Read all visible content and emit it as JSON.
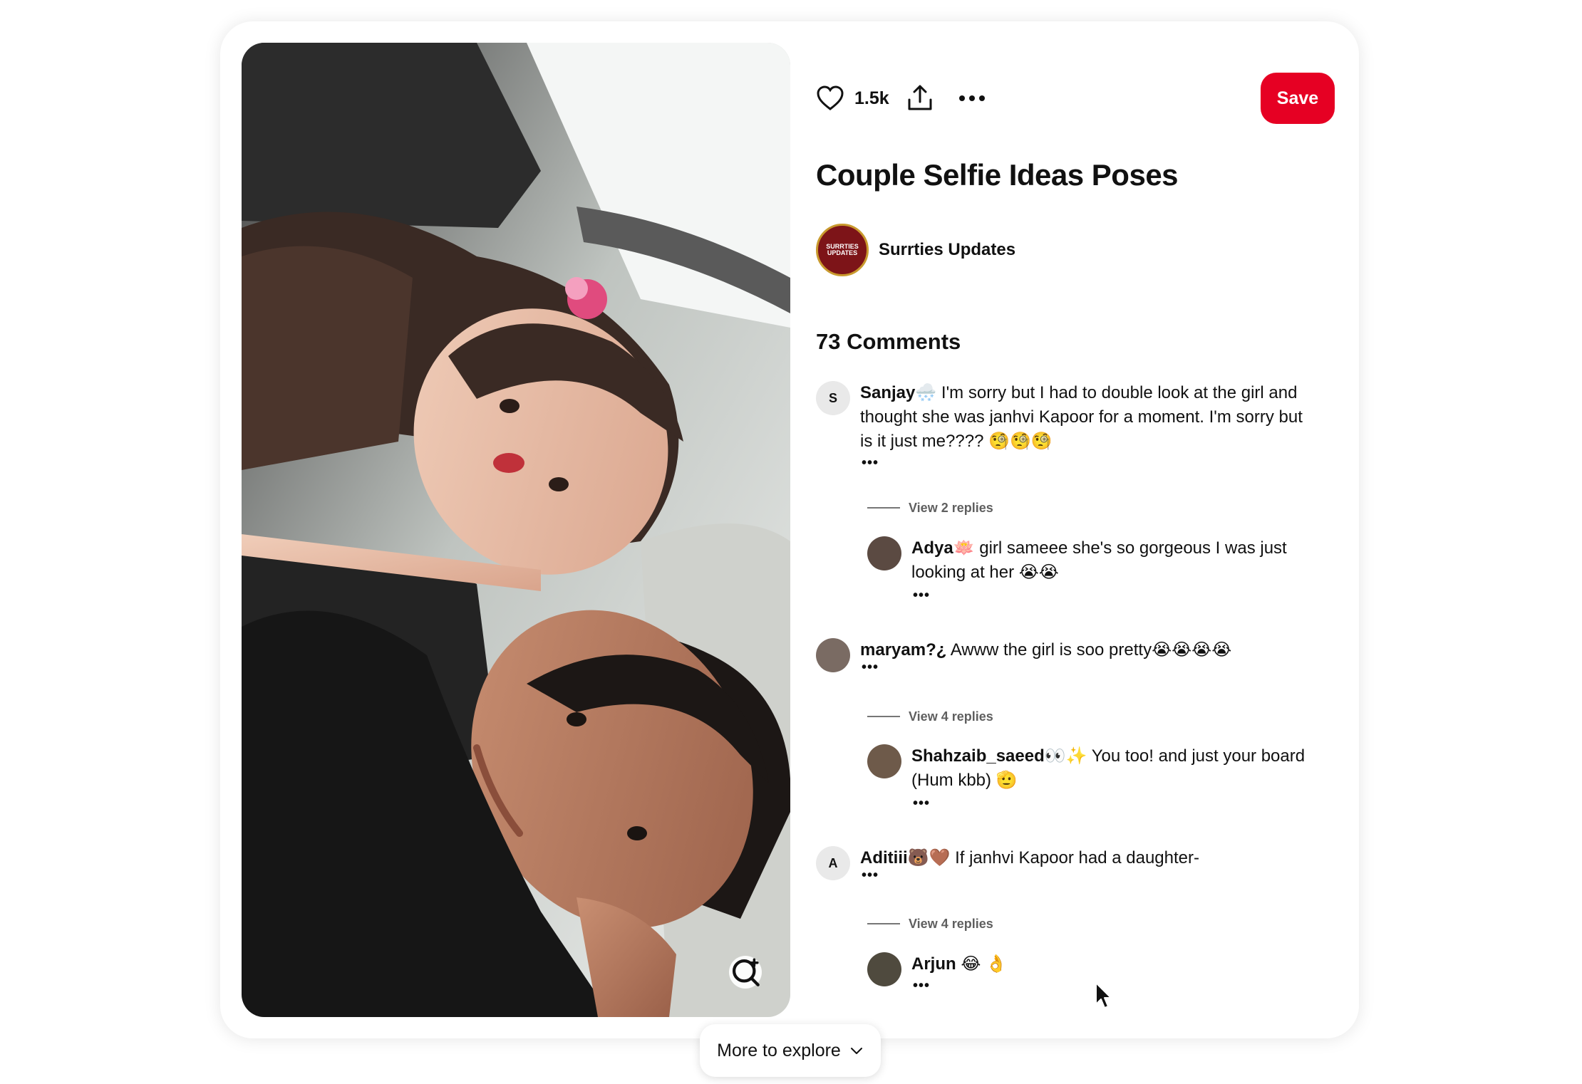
{
  "pin": {
    "like_count": "1.5k",
    "save_label": "Save",
    "title": "Couple Selfie Ideas Poses",
    "creator": {
      "name": "Surrties Updates",
      "avatar_text": "SURRTIES UPDATES"
    },
    "comments_heading": "73 Comments"
  },
  "comments": [
    {
      "avatar_letter": "S",
      "user": "Sanjay🌨️",
      "text": " I'm sorry but I had to double look at the girl and thought she was janhvi Kapoor for a moment. I'm sorry but is it just me???? 🧐🧐🧐",
      "view_replies": "View 2 replies",
      "reply": {
        "user": "Adya🪷",
        "text": " girl sameee she's so gorgeous I was just looking at her 😭😭"
      }
    },
    {
      "avatar_letter": "",
      "user": "maryam?¿",
      "text": " Awww the girl is soo pretty😭😭😭😭",
      "view_replies": "View 4 replies",
      "reply": {
        "user": "Shahzaib_saeed👀✨",
        "text": " You too! and just your board (Hum kbb) 🫡"
      }
    },
    {
      "avatar_letter": "A",
      "user": "Aditiii🐻🤎",
      "text": " If janhvi Kapoor had a daughter-",
      "view_replies": "View 4 replies",
      "reply": {
        "user": "Arjun",
        "text": " 😂 👌"
      }
    }
  ],
  "dots": "•••",
  "more_to_explore": "More to explore",
  "colors": {
    "save": "#e60023",
    "text": "#111111",
    "muted": "#5f5f5f"
  },
  "icons": [
    "heart-icon",
    "share-icon",
    "more-icon",
    "visual-search-icon",
    "chevron-down-icon",
    "cursor-icon"
  ]
}
